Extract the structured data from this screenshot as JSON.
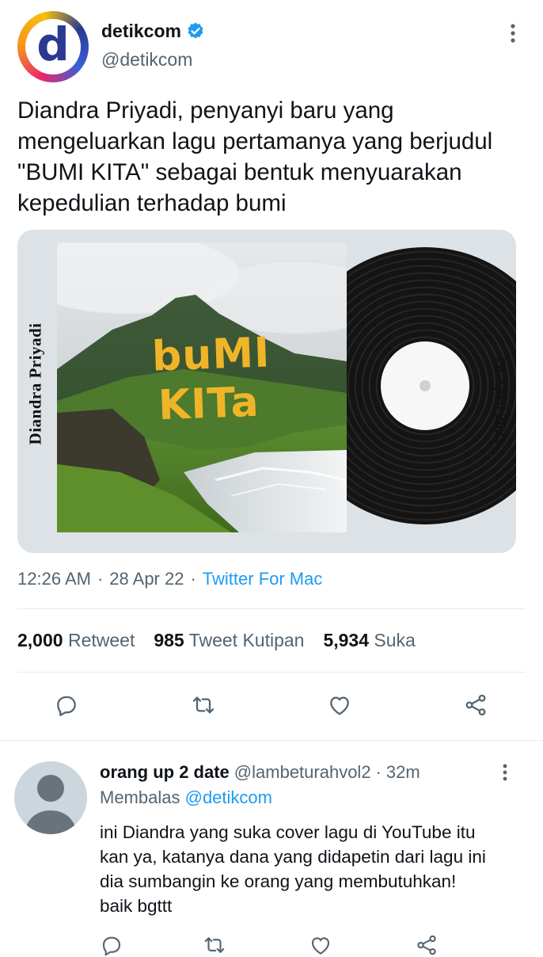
{
  "tweet": {
    "author_name": "detikcom",
    "author_handle": "@detikcom",
    "verified": true,
    "avatar_letter": "d",
    "text": "Diandra Priyadi, penyanyi baru yang mengeluarkan lagu pertamanya yang berjudul \"BUMI KITA\" sebagai bentuk menyuarakan kepedulian terhadap bumi",
    "media": {
      "artist_side_text": "Diandra Priyadi",
      "cover_title_line1": "buMI",
      "cover_title_line2": "KITa",
      "date_side_text": "28 April 2022"
    },
    "time": "12:26 AM",
    "date": "28 Apr 22",
    "source": "Twitter For Mac",
    "dot": "·",
    "stats": {
      "retweets_count": "2,000",
      "retweets_label": "Retweet",
      "quotes_count": "985",
      "quotes_label": "Tweet Kutipan",
      "likes_count": "5,934",
      "likes_label": "Suka"
    }
  },
  "reply": {
    "author_name": "orang up 2 date",
    "author_handle": "@lambeturahvol2",
    "time_ago": "32m",
    "dot": "·",
    "replying_label": "Membalas",
    "replying_to": "@detikcom",
    "text": "ini Diandra yang suka cover lagu di YouTube itu kan ya, katanya dana yang didapetin dari lagu ini dia sumbangin ke orang yang membutuhkan! baik bgttt"
  },
  "colors": {
    "accent": "#1d9bf0",
    "muted": "#536471",
    "cover_title": "#f0b429"
  },
  "icons": [
    "more-vertical-icon",
    "verified-badge-icon",
    "reply-icon",
    "retweet-icon",
    "like-icon",
    "share-icon"
  ]
}
